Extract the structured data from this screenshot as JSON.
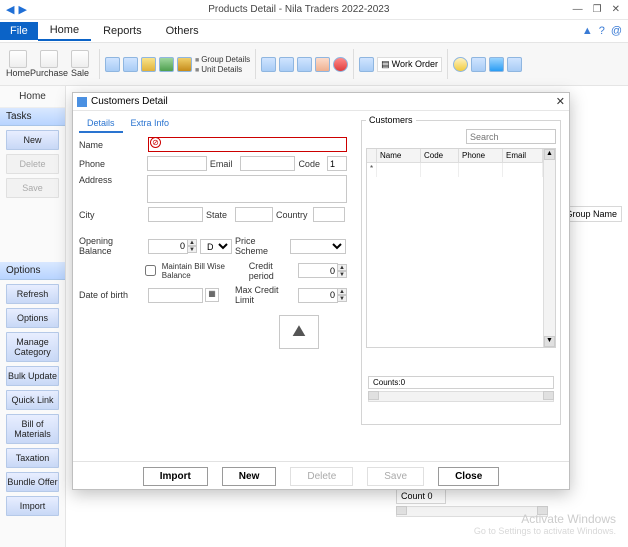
{
  "window": {
    "title": "Products Detail - Nila Traders 2022-2023",
    "min": "—",
    "restore": "❐",
    "close": "✕"
  },
  "nav": {
    "back": "◀",
    "fwd": "▶"
  },
  "menu": {
    "file": "File",
    "home": "Home",
    "reports": "Reports",
    "others": "Others"
  },
  "toolbar": {
    "home": "Home",
    "purchase": "Purchase",
    "sale": "Sale",
    "group_details": "Group Details",
    "unit_details": "Unit Details",
    "work_order": "Work Order"
  },
  "sidebar": {
    "sub_home": "Home",
    "tasks_header": "Tasks",
    "tasks": {
      "new": "New",
      "delete": "Delete",
      "save": "Save"
    },
    "options_header": "Options",
    "opts": [
      "Refresh",
      "Options",
      "Manage Category",
      "Bulk Update",
      "Quick Link",
      "Bill of Materials",
      "Taxation",
      "Bundle Offer",
      "Import"
    ]
  },
  "bg": {
    "group_name": "Group Name",
    "count": "Count 0",
    "wm_title": "Activate Windows",
    "wm_sub": "Go to Settings to activate Windows."
  },
  "dialog": {
    "title": "Customers Detail",
    "tabs": {
      "details": "Details",
      "extra": "Extra Info"
    },
    "fields": {
      "name": "Name",
      "phone": "Phone",
      "email": "Email",
      "code": "Code",
      "code_val": "1",
      "address": "Address",
      "city": "City",
      "state": "State",
      "country": "Country",
      "ob": "Opening Balance",
      "ob_val": "0",
      "db": "DB",
      "price_scheme": "Price Scheme",
      "maintain": "Maintain Bill Wise Balance",
      "credit_period": "Credit period",
      "credit_period_val": "0",
      "dob": "Date of birth",
      "max_credit": "Max Credit Limit",
      "max_credit_val": "0"
    },
    "customers": {
      "legend": "Customers",
      "search_ph": "Search",
      "cols": {
        "name": "Name",
        "code": "Code",
        "phone": "Phone",
        "email": "Email"
      },
      "counts": "Counts:0"
    },
    "footer": {
      "import": "Import",
      "new": "New",
      "delete": "Delete",
      "save": "Save",
      "close": "Close"
    }
  }
}
